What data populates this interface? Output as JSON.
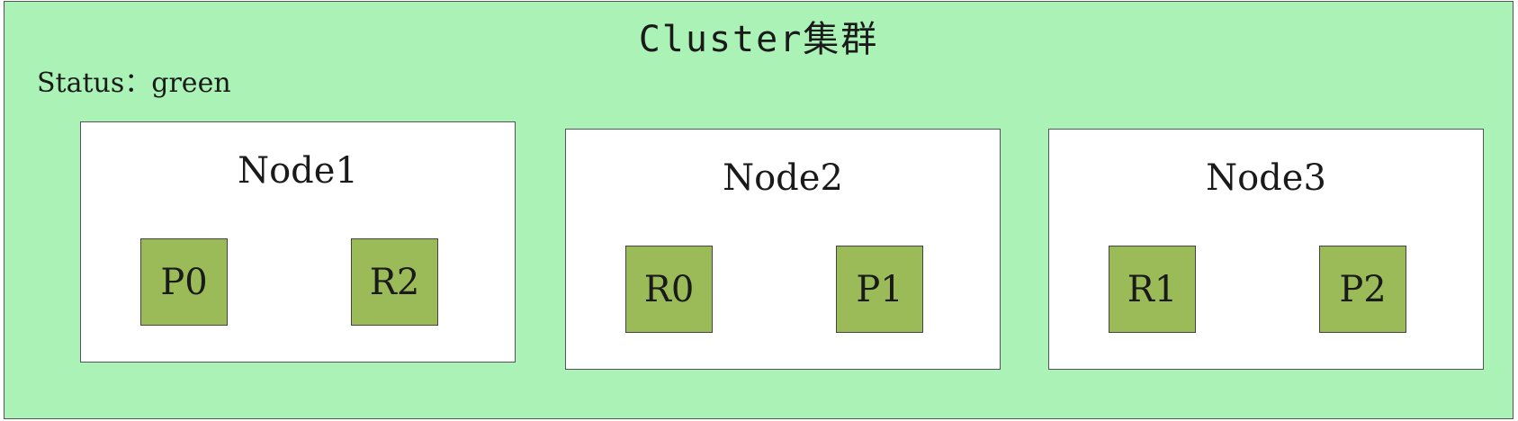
{
  "cluster": {
    "title": "Cluster集群",
    "status": "Status：green"
  },
  "nodes": [
    {
      "label": "Node1",
      "shards": [
        "P0",
        "R2"
      ]
    },
    {
      "label": "Node2",
      "shards": [
        "R0",
        "P1"
      ]
    },
    {
      "label": "Node3",
      "shards": [
        "R1",
        "P2"
      ]
    }
  ],
  "colors": {
    "cluster_background": "#aaf2b5",
    "node_background": "#ffffff",
    "shard_background": "#9bbb59"
  }
}
